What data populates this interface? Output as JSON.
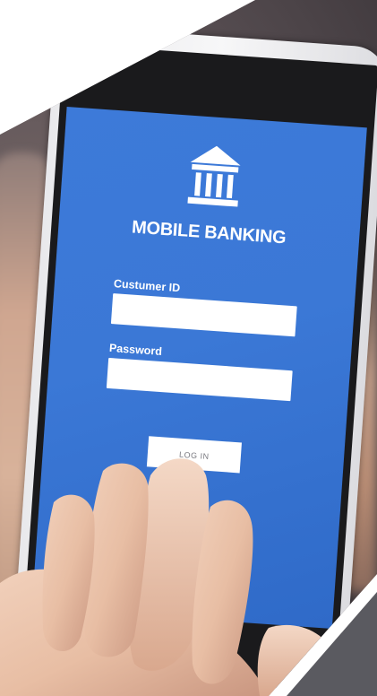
{
  "app": {
    "title": "MOBILE BANKING",
    "icon": "bank-building-icon"
  },
  "form": {
    "customer_id_label": "Custumer ID",
    "customer_id_value": "",
    "password_label": "Password",
    "password_value": "",
    "login_label": "LOG IN"
  },
  "colors": {
    "screen_blue": "#3b78d6",
    "text": "#ffffff"
  }
}
